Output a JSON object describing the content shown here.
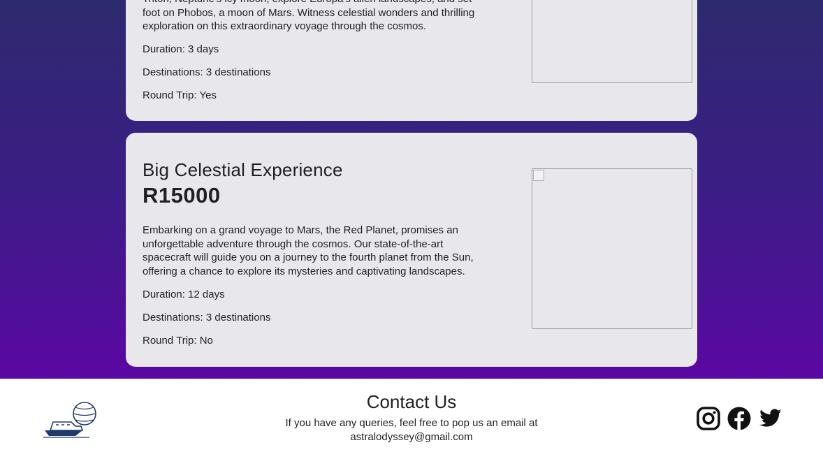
{
  "trip1": {
    "description": "Triton, Neptune's icy moon, explore Europa's alien landscapes, and set foot on Phobos, a moon of Mars. Witness celestial wonders and thrilling exploration on this extraordinary voyage through the cosmos.",
    "duration": "Duration: 3 days",
    "destinations": "Destinations: 3 destinations",
    "round_trip": "Round Trip: Yes"
  },
  "trip2": {
    "title": "Big Celestial Experience",
    "price": "R15000",
    "description": "Embarking on a grand voyage to Mars, the Red Planet, promises an unforgettable adventure through the cosmos. Our state-of-the-art spacecraft will guide you on a journey to the fourth planet from the Sun, offering a chance to explore its mysteries and captivating landscapes.",
    "duration": "Duration: 12 days",
    "destinations": "Destinations: 3 destinations",
    "round_trip": "Round Trip: No"
  },
  "footer": {
    "contact_title": "Contact Us",
    "contact_text": "If you have any queries, feel free to pop us an email at astralodyssey@gmail.com",
    "icons": [
      "instagram-icon",
      "facebook-icon",
      "twitter-icon",
      "logo-ship-icon"
    ]
  },
  "colors": {
    "bg_top": "#2e2a6e",
    "bg_bottom": "#5b07a3",
    "card": "#e8e8ec",
    "text": "#1f1f24"
  }
}
